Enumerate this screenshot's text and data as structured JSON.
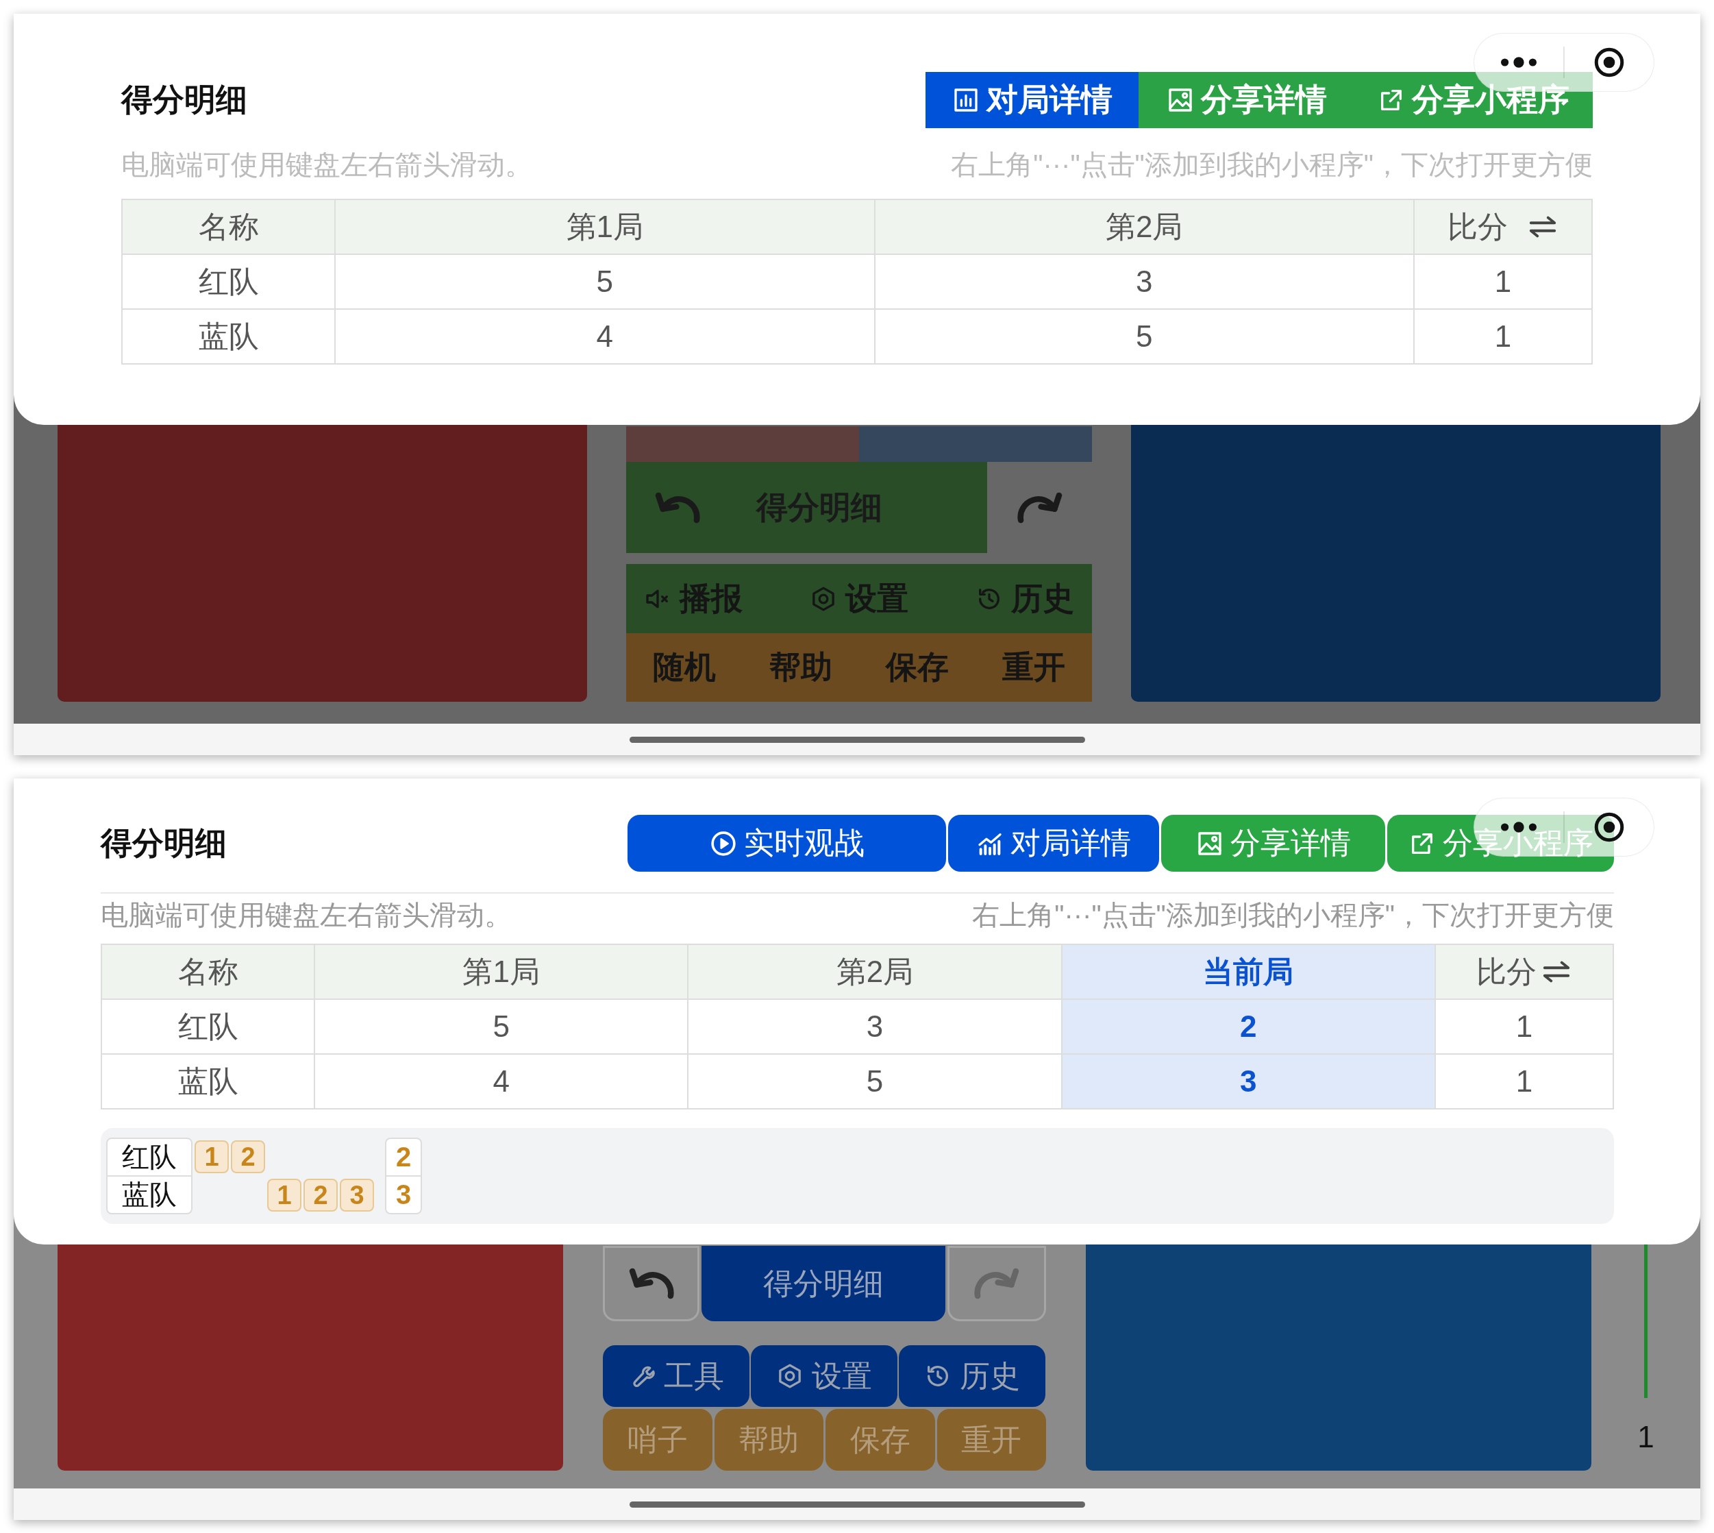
{
  "frames": [
    {
      "sheet": {
        "title": "得分明细",
        "actions": [
          {
            "label": "对局详情",
            "color": "#0052d9"
          },
          {
            "label": "分享详情",
            "color": "#2ba245"
          },
          {
            "label": "分享小程序",
            "color": "#2ba245"
          }
        ],
        "hint_left": "电脑端可使用键盘左右箭头滑动。",
        "hint_right": "右上角\"···\"点击\"添加到我的小程序\"，下次打开更方便",
        "table": {
          "columns": [
            {
              "label": "名称",
              "kind": "name",
              "current": false
            },
            {
              "label": "第1局",
              "kind": "round",
              "current": false
            },
            {
              "label": "第2局",
              "kind": "round",
              "current": false
            },
            {
              "label": "比分",
              "kind": "score",
              "current": false
            }
          ],
          "rows": [
            {
              "cells": [
                "红队",
                "5",
                "3",
                "1"
              ]
            },
            {
              "cells": [
                "蓝队",
                "4",
                "5",
                "1"
              ]
            }
          ]
        }
      },
      "game": {
        "main_button": "得分明细",
        "tools": [
          "播报",
          "设置",
          "历史"
        ],
        "extras": [
          "随机",
          "帮助",
          "保存",
          "重开"
        ]
      }
    },
    {
      "sheet": {
        "title": "得分明细",
        "actions": [
          {
            "label": "实时观战",
            "color": "#0052d9"
          },
          {
            "label": "对局详情",
            "color": "#0052d9"
          },
          {
            "label": "分享详情",
            "color": "#2aa745"
          },
          {
            "label": "分享小程序",
            "color": "#2aa745"
          }
        ],
        "hint_left": "电脑端可使用键盘左右箭头滑动。",
        "hint_right": "右上角\"···\"点击\"添加到我的小程序\"，下次打开更方便",
        "table": {
          "columns": [
            {
              "label": "名称",
              "kind": "name",
              "current": false
            },
            {
              "label": "第1局",
              "kind": "round",
              "current": false
            },
            {
              "label": "第2局",
              "kind": "round",
              "current": false
            },
            {
              "label": "当前局",
              "kind": "round",
              "current": true
            },
            {
              "label": "比分",
              "kind": "score",
              "current": false
            }
          ],
          "rows": [
            {
              "cells": [
                "红队",
                "5",
                "3",
                "2",
                "1"
              ]
            },
            {
              "cells": [
                "蓝队",
                "4",
                "5",
                "3",
                "1"
              ]
            }
          ]
        },
        "timeline": {
          "rows": [
            {
              "team": "红队",
              "slots": [
                {
                  "kind": "point",
                  "text": "1"
                },
                {
                  "kind": "point",
                  "text": "2"
                },
                {
                  "kind": "empty"
                },
                {
                  "kind": "empty"
                },
                {
                  "kind": "empty"
                }
              ],
              "total": "2"
            },
            {
              "team": "蓝队",
              "slots": [
                {
                  "kind": "empty"
                },
                {
                  "kind": "empty"
                },
                {
                  "kind": "point",
                  "text": "1"
                },
                {
                  "kind": "point",
                  "text": "2"
                },
                {
                  "kind": "point",
                  "text": "3"
                }
              ],
              "total": "3"
            }
          ]
        }
      },
      "game": {
        "main_button": "得分明细",
        "tools": [
          "工具",
          "设置",
          "历史"
        ],
        "extras": [
          "哨子",
          "帮助",
          "保存",
          "重开"
        ],
        "side": {
          "label": "1"
        }
      }
    }
  ]
}
